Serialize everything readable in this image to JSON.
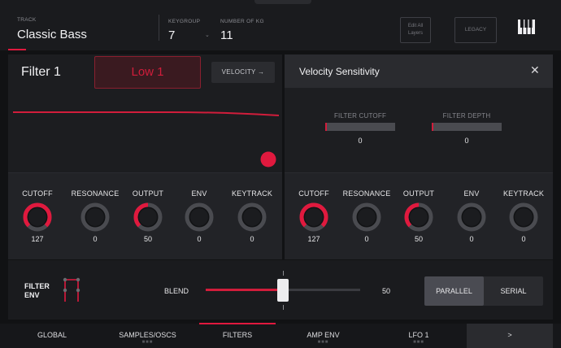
{
  "header": {
    "track_caption": "TRACK",
    "track_name": "Classic Bass",
    "keygroup_caption": "KEYGROUP",
    "keygroup_value": "7",
    "num_kg_caption": "NUMBER OF KG",
    "num_kg_value": "11",
    "edit_all_layers": "Edit All Layers",
    "legacy": "LEGACY",
    "keys_icon": "piano-keys-icon"
  },
  "filter": {
    "title": "Filter 1",
    "type": "Low 1",
    "velocity_button": "VELOCITY →",
    "knobs": [
      {
        "label": "CUTOFF",
        "value": "127",
        "level": 1.0
      },
      {
        "label": "RESONANCE",
        "value": "0",
        "level": 0.0
      },
      {
        "label": "OUTPUT",
        "value": "50",
        "level": 0.5
      },
      {
        "label": "ENV",
        "value": "0",
        "level": 0.0
      },
      {
        "label": "KEYTRACK",
        "value": "0",
        "level": 0.0
      }
    ]
  },
  "velocity_sensitivity": {
    "title": "Velocity Sensitivity",
    "close_icon": "close-icon",
    "filter_cutoff_label": "FILTER CUTOFF",
    "filter_cutoff_value": "0",
    "filter_depth_label": "FILTER DEPTH",
    "filter_depth_value": "0",
    "knobs": [
      {
        "label": "CUTOFF",
        "value": "127",
        "level": 1.0
      },
      {
        "label": "RESONANCE",
        "value": "0",
        "level": 0.0
      },
      {
        "label": "OUTPUT",
        "value": "50",
        "level": 0.5
      },
      {
        "label": "ENV",
        "value": "0",
        "level": 0.0
      },
      {
        "label": "KEYTRACK",
        "value": "0",
        "level": 0.0
      }
    ]
  },
  "env": {
    "label_line1": "FILTER",
    "label_line2": "ENV",
    "blend_label": "BLEND",
    "blend_value": "50",
    "blend_level": 0.5,
    "parallel": "PARALLEL",
    "serial": "SERIAL",
    "selected_mode": "PARALLEL"
  },
  "tabs": [
    {
      "label": "GLOBAL",
      "has_dots": false
    },
    {
      "label": "SAMPLES/OSCS",
      "has_dots": true
    },
    {
      "label": "FILTERS",
      "has_dots": false,
      "active": true
    },
    {
      "label": "AMP ENV",
      "has_dots": true
    },
    {
      "label": "LFO 1",
      "has_dots": true
    },
    {
      "label": ">",
      "has_dots": false
    }
  ],
  "colors": {
    "accent": "#e0193e",
    "panel": "#1c1d20",
    "background": "#111214"
  }
}
